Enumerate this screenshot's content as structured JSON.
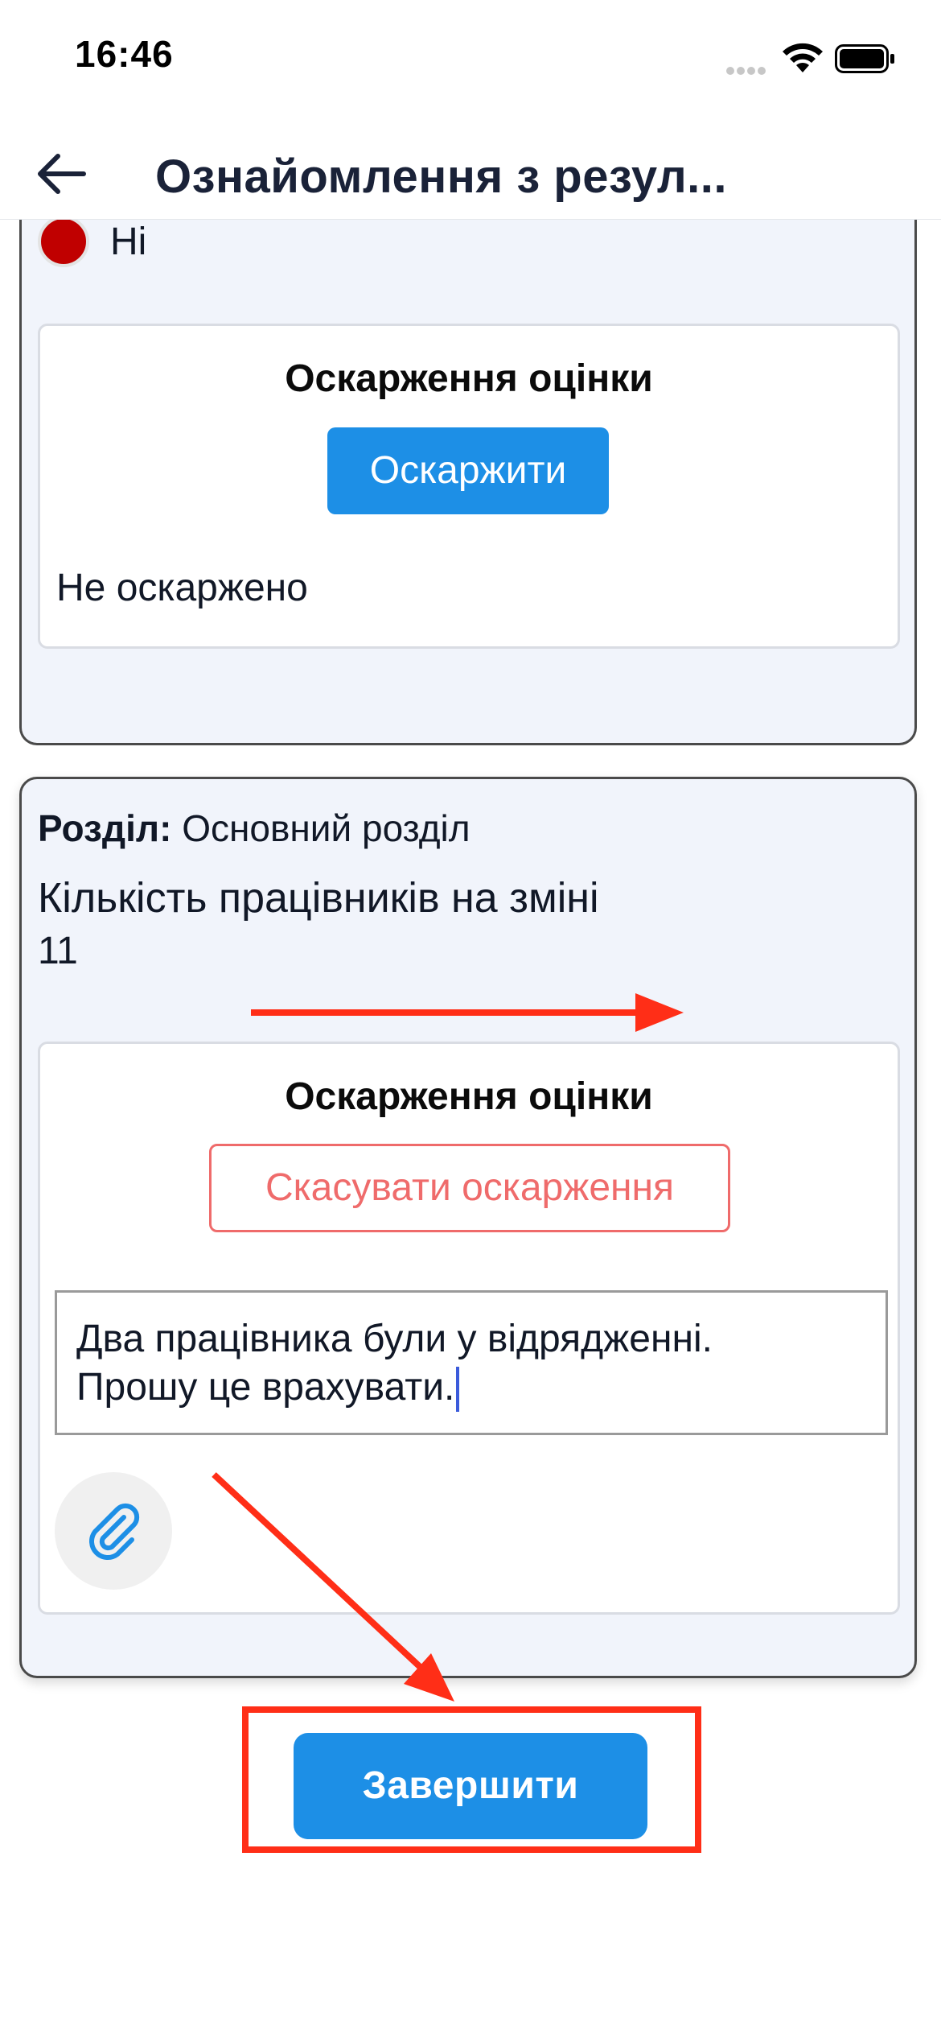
{
  "status_bar": {
    "time": "16:46"
  },
  "header": {
    "back_icon": "arrow-left-icon",
    "title": "Ознайомлення з резул..."
  },
  "card_top": {
    "radio_label": "Ні",
    "radio_color": "#c00000",
    "appeal": {
      "title": "Оскарження оцінки",
      "button_label": "Оскаржити",
      "status": "Не оскаржено"
    }
  },
  "card_bottom": {
    "section_label": "Розділ:",
    "section_value": "Основний розділ",
    "metric_name": "Кількість працівників на зміні",
    "metric_value": "11",
    "appeal": {
      "title": "Оскарження оцінки",
      "cancel_label": "Скасувати оскарження",
      "comment_line1": "Два працівника були у відрядженні.",
      "comment_line2": "Прошу це врахувати.",
      "attach_icon": "paperclip-icon"
    }
  },
  "footer": {
    "finish_label": "Завершити"
  },
  "colors": {
    "primary": "#1d8fe6",
    "danger_outline": "#ef6b6b",
    "annotation_red": "#ff2e17",
    "card_bg": "#f1f4fb"
  }
}
